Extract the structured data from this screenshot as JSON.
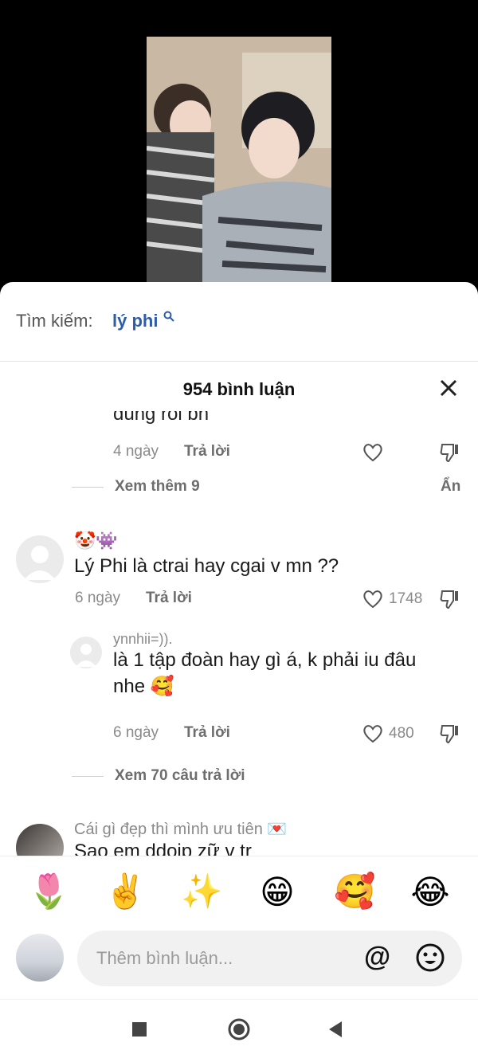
{
  "search": {
    "prefix": "Tìm kiếm:",
    "term": "lý phi"
  },
  "comments_header": {
    "title": "954 bình luận"
  },
  "comments": {
    "cut_reply": {
      "text": "đúng rồi bh",
      "time": "4 ngày",
      "reply_label": "Trả lời"
    },
    "view_more": "Xem thêm 9",
    "hide": "Ẩn",
    "comment1": {
      "username": "🤡👾",
      "text": "Lý Phi là ctrai hay cgai v mn ??",
      "time": "6 ngày",
      "reply_label": "Trả lời",
      "likes": "1748"
    },
    "reply1": {
      "username": "ynnhii=)).",
      "text": "là 1 tập đoàn hay gì á, k phải iu đâu nhe 🥰",
      "time": "6 ngày",
      "reply_label": "Trả lời",
      "likes": "480"
    },
    "view_replies": "Xem 70 câu trả lời",
    "comment2": {
      "username": "Cái gì đẹp thì mình ưu tiên 💌",
      "text": "Sao em ddoip zữ v tr"
    }
  },
  "emoji_bar": [
    "🌷",
    "✌️",
    "✨",
    "😁",
    "🥰",
    "😂"
  ],
  "composer": {
    "placeholder": "Thêm bình luận..."
  },
  "icons": {
    "search": "search-icon",
    "close": "close-icon",
    "heart": "heart-icon",
    "dislike": "thumbs-down-icon",
    "at": "at-icon",
    "emoji": "smile-icon",
    "nav": [
      "square-icon",
      "circle-icon",
      "back-triangle-icon"
    ]
  },
  "colors": {
    "accent_blue": "#2d5da8",
    "muted": "#8a8a8a"
  }
}
